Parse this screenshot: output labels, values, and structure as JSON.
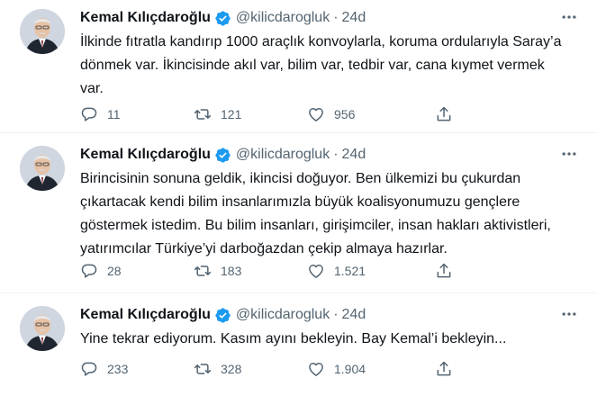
{
  "tweets": [
    {
      "name": "Kemal Kılıçdaroğlu",
      "handle": "@kilicdarogluk",
      "separator": "·",
      "time": "24d",
      "text": "İlkinde fıtratla kandırıp 1000 araçlık konvoylarla, koruma ordularıyla Saray’a\ndönmek var. İkincisinde akıl var, bilim var, tedbir var, cana kıymet vermek\nvar.",
      "replies": "11",
      "retweets": "121",
      "likes": "956"
    },
    {
      "name": "Kemal Kılıçdaroğlu",
      "handle": "@kilicdarogluk",
      "separator": "·",
      "time": "24d",
      "text": "Birincisinin sonuna geldik, ikincisi doğuyor. Ben ülkemizi bu çukurdan\nçıkartacak kendi bilim insanlarımızla büyük koalisyonumuzu gençlere\ngöstermek istedim. Bu bilim insanları, girişimciler, insan hakları aktivistleri,\nyatırımcılar Türkiye’yi darboğazdan çekip almaya hazırlar.",
      "replies": "28",
      "retweets": "183",
      "likes": "1.521"
    },
    {
      "name": "Kemal Kılıçdaroğlu",
      "handle": "@kilicdarogluk",
      "separator": "·",
      "time": "24d",
      "text": "Yine tekrar ediyorum. Kasım ayını bekleyin. Bay Kemal’i bekleyin...",
      "replies": "233",
      "retweets": "328",
      "likes": "1.904"
    }
  ],
  "icons": {
    "verified": "verified-badge-icon",
    "more": "more-options-icon",
    "reply": "reply-icon",
    "retweet": "retweet-icon",
    "like": "like-icon",
    "share": "share-icon"
  },
  "colors": {
    "text": "#0f1419",
    "muted": "#536471",
    "verified": "#1d9bf0",
    "divider": "#eff3f4"
  }
}
